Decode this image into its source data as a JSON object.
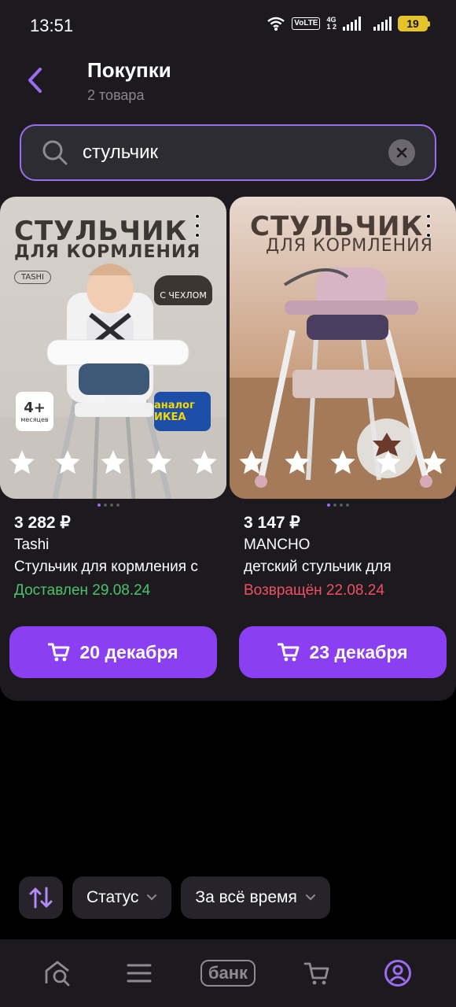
{
  "status_bar": {
    "time": "13:51",
    "volte": "VoLTE",
    "net_top": "4G",
    "net_bottom": "1 2",
    "battery": "19"
  },
  "header": {
    "title": "Покупки",
    "subtitle": "2 товара"
  },
  "search": {
    "value": "стульчик",
    "placeholder": ""
  },
  "products": [
    {
      "image_title": "СТУЛЬЧИК",
      "image_subtitle": "ДЛЯ КОРМЛЕНИЯ",
      "image_tag": "TASHI",
      "image_badge_cover": "С ЧЕХЛОМ",
      "image_badge_age": "4+",
      "image_badge_age_sub": "месяцев",
      "image_badge_ikea": "аналог ИКЕА",
      "price": "3 282 ₽",
      "brand": "Tashi",
      "name": "Стульчик для кормления с",
      "status": "Доставлен 29.08.24",
      "status_type": "delivered",
      "status_color": "#4cc26a",
      "cart_label": "20 декабря",
      "rating_stars": 5
    },
    {
      "image_title": "СТУЛЬЧИК",
      "image_subtitle": "ДЛЯ КОРМЛЕНИЯ",
      "price": "3 147 ₽",
      "brand": "MANCHO",
      "name": "детский стульчик для",
      "status": "Возвращён 22.08.24",
      "status_type": "returned",
      "status_color": "#f05060",
      "cart_label": "23 декабря",
      "rating_stars": 5
    }
  ],
  "filters": {
    "status_label": "Статус",
    "period_label": "За всё время"
  },
  "bottom_nav": {
    "bank_label": "банк",
    "items": [
      "home-search-icon",
      "catalog-icon",
      "bank-icon",
      "cart-icon",
      "profile-icon"
    ],
    "active": "profile-icon"
  },
  "colors": {
    "accent": "#8a3ff2",
    "accent_light": "#9b6cf0",
    "background": "#000000",
    "surface": "#1c1a1f"
  }
}
